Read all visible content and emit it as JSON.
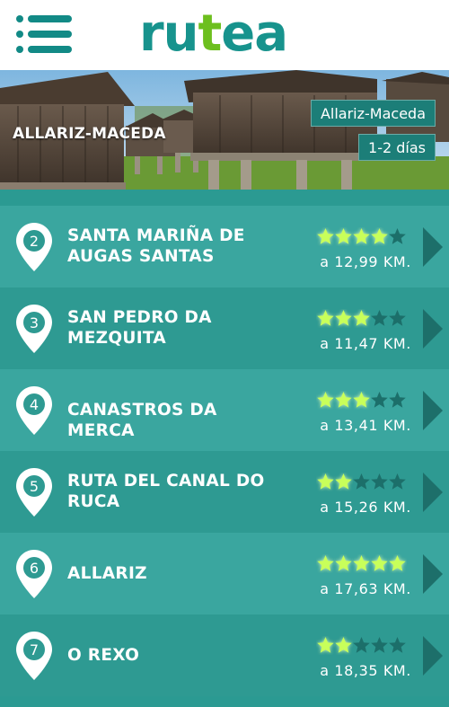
{
  "header": {
    "menu_icon": "hamburger-menu-icon",
    "logo_part1": "ru",
    "logo_part2": "t",
    "logo_part3": "ea",
    "brand_colors": {
      "teal": "#17938d",
      "green": "#6dbf1e"
    }
  },
  "hero": {
    "title": "ALLARIZ-MACEDA",
    "route_chip": "Allariz-Maceda",
    "duration_chip": "1-2 días"
  },
  "routes": [
    {
      "number": "2",
      "title_line1": "SANTA MARIÑA DE",
      "title_line2": "AUGAS SANTAS",
      "rating": 4,
      "distance": "a 12,99 KM."
    },
    {
      "number": "3",
      "title_line1": "SAN PEDRO DA",
      "title_line2": "MEZQUITA",
      "rating": 3,
      "distance": "a 11,47 KM."
    },
    {
      "number": "4",
      "title_line1": "CANASTROS DA MERCA",
      "title_line2": "",
      "rating": 3,
      "distance": "a 13,41 KM."
    },
    {
      "number": "5",
      "title_line1": "RUTA DEL CANAL DO",
      "title_line2": "RUCA",
      "rating": 2,
      "distance": "a 15,26 KM."
    },
    {
      "number": "6",
      "title_line1": "ALLARIZ",
      "title_line2": "",
      "rating": 5,
      "distance": "a 17,63 KM."
    },
    {
      "number": "7",
      "title_line1": "O REXO",
      "title_line2": "",
      "rating": 2,
      "distance": "a 18,35 KM."
    }
  ],
  "colors": {
    "star_on": "#c8ff5a",
    "star_off": "#1c6f6a",
    "row_odd": "#3aa69f",
    "row_even": "#2e9a92"
  }
}
